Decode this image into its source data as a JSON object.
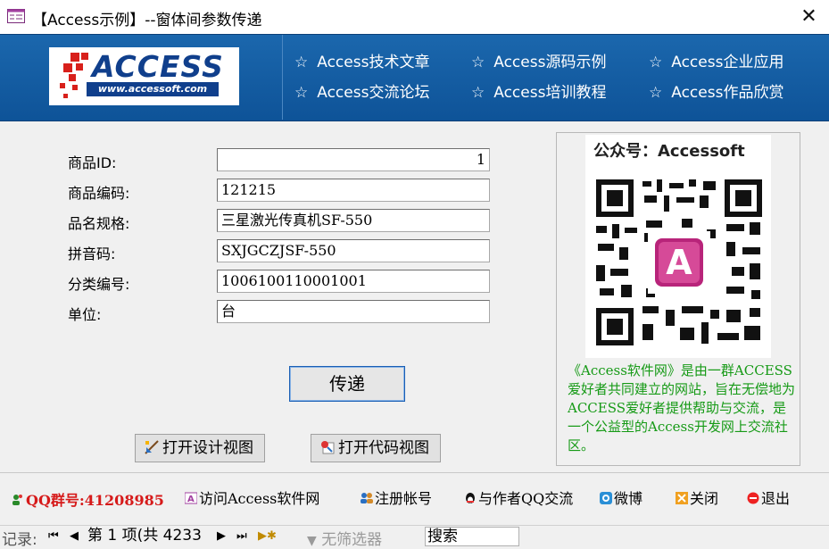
{
  "window": {
    "title": "【Access示例】--窗体间参数传递",
    "close_glyph": "✕"
  },
  "header": {
    "logo_text": "ACCESS",
    "logo_url": "www.accessoft.com",
    "nav": [
      "Access技术文章",
      "Access源码示例",
      "Access企业应用",
      "Access交流论坛",
      "Access培训教程",
      "Access作品欣赏"
    ],
    "star": "☆"
  },
  "form": {
    "fields": [
      {
        "label": "商品ID:",
        "value": "1"
      },
      {
        "label": "商品编码:",
        "value": "121215"
      },
      {
        "label": "品名规格:",
        "value": "三星激光传真机SF-550"
      },
      {
        "label": "拼音码:",
        "value": "SXJGCZJSF-550"
      },
      {
        "label": "分类编号:",
        "value": "1006100110001001"
      },
      {
        "label": "单位:",
        "value": "台"
      }
    ],
    "pass_button": "传递",
    "design_view_button": "打开设计视图",
    "code_view_button": "打开代码视图"
  },
  "qr": {
    "title": "公众号：Accessoft",
    "description": "《Access软件网》是由一群ACCESS爱好者共同建立的网站，旨在无偿地为ACCESS爱好者提供帮助与交流，是一个公益型的Access开发网上交流社区。"
  },
  "links": {
    "qq_group": "QQ群号:41208985",
    "visit_site": "访问Access软件网",
    "register": "注册帐号",
    "qq_author": "与作者QQ交流",
    "weibo": "微博",
    "close": "关闭",
    "exit": "退出"
  },
  "recordbar": {
    "label": "记录:",
    "position": "第 1 项(共 4233",
    "filter": "无筛选器",
    "search": "搜索"
  },
  "colors": {
    "header_blue": "#1565ab",
    "qr_text_green": "#169a16",
    "qq_red": "#d61a1a"
  }
}
